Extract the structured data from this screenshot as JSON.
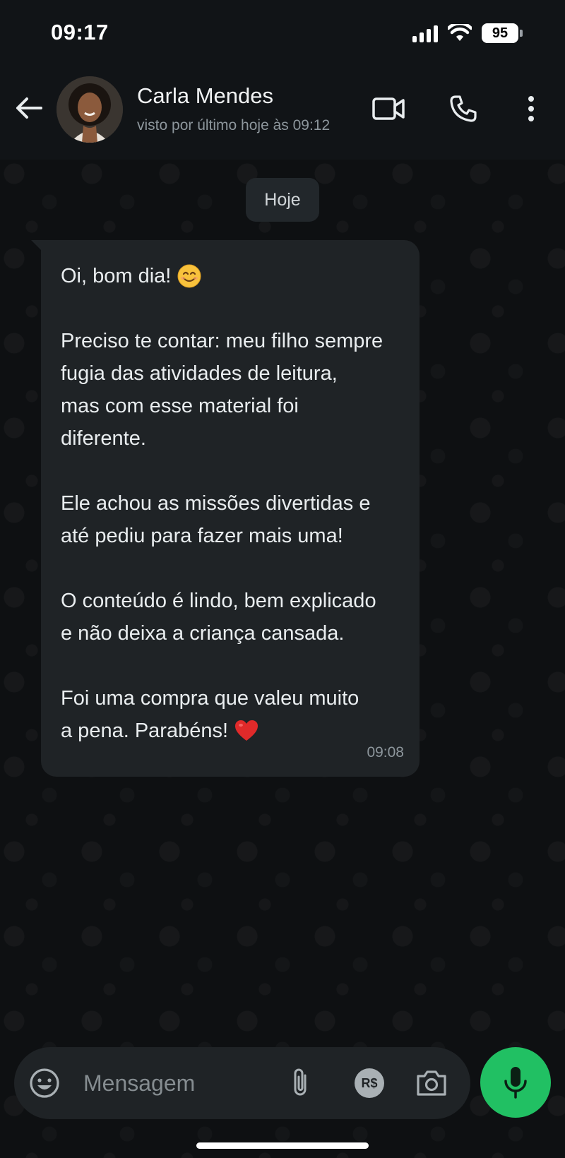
{
  "status_bar": {
    "time": "09:17",
    "battery": "95",
    "icons": [
      "cellular-signal-icon",
      "wifi-icon",
      "battery-icon"
    ]
  },
  "header": {
    "contact_name": "Carla Mendes",
    "last_seen": "visto por último hoje às 09:12",
    "icons": [
      "back-arrow-icon",
      "video-call-icon",
      "phone-call-icon",
      "more-options-icon"
    ]
  },
  "chat": {
    "date_label": "Hoje",
    "message": {
      "paragraphs": [
        {
          "lines": [
            "Oi, bom dia!"
          ],
          "trailing_emoji": "smiling-face-emoji"
        },
        {
          "lines": [
            "Preciso te contar: meu filho sempre",
            "fugia das atividades de leitura,",
            "mas com esse material foi",
            "diferente."
          ]
        },
        {
          "lines": [
            "Ele achou as missões divertidas e",
            "até pediu para fazer mais uma!"
          ]
        },
        {
          "lines": [
            "O conteúdo é lindo, bem explicado",
            "e não deixa a criança cansada."
          ]
        },
        {
          "lines": [
            "Foi uma compra que valeu muito",
            "a pena. Parabéns!"
          ],
          "trailing_emoji": "red-heart-emoji"
        }
      ],
      "time": "09:08"
    }
  },
  "composer": {
    "placeholder": "Mensagem",
    "payment_label": "R$",
    "icons": [
      "emoji-icon",
      "attachment-icon",
      "payment-icon",
      "camera-icon",
      "microphone-icon"
    ]
  },
  "colors": {
    "background": "#0e1012",
    "header": "#111417",
    "bubble": "#1f2326",
    "accent_green": "#21c063",
    "secondary_text": "#8d969c"
  }
}
